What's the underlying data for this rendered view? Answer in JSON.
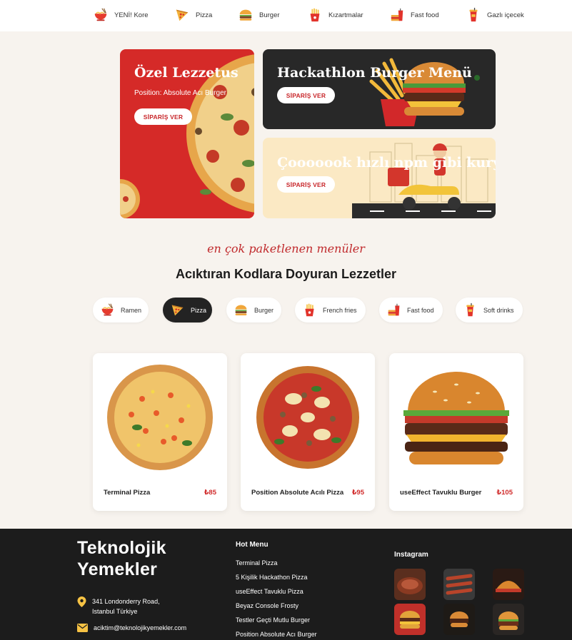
{
  "nav": {
    "items": [
      {
        "label": "YENİ! Kore",
        "icon": "ramen-icon"
      },
      {
        "label": "Pizza",
        "icon": "pizza-icon"
      },
      {
        "label": "Burger",
        "icon": "burger-icon"
      },
      {
        "label": "Kızartmalar",
        "icon": "fries-icon"
      },
      {
        "label": "Fast food",
        "icon": "fast-food-icon"
      },
      {
        "label": "Gazlı içecek",
        "icon": "soda-icon"
      }
    ]
  },
  "hero": {
    "red_card": {
      "title": "Özel Lezzetus",
      "subtitle": "Position: Absolute Acı Burger",
      "button": "SİPARİŞ VER"
    },
    "dark_card": {
      "title": "Hackathlon Burger Menü",
      "button": "SİPARİŞ VER"
    },
    "cream_card": {
      "title": "Çooooook hızlı npm gibi kurye",
      "button": "SİPARİŞ VER"
    }
  },
  "section": {
    "tagline": "en çok paketlenen menüler",
    "title": "Acıktıran Kodlara Doyuran Lezzetler"
  },
  "categories": [
    {
      "label": "Ramen",
      "icon": "ramen-icon",
      "active": false
    },
    {
      "label": "Pizza",
      "icon": "pizza-icon",
      "active": true
    },
    {
      "label": "Burger",
      "icon": "burger-icon",
      "active": false
    },
    {
      "label": "French fries",
      "icon": "fries-icon",
      "active": false
    },
    {
      "label": "Fast food",
      "icon": "fast-food-icon",
      "active": false
    },
    {
      "label": "Soft drinks",
      "icon": "soda-icon",
      "active": false
    }
  ],
  "products": [
    {
      "name": "Terminal Pizza",
      "price": "₺85"
    },
    {
      "name": "Position Absolute Acılı Pizza",
      "price": "₺95"
    },
    {
      "name": "useEffect Tavuklu Burger",
      "price": "₺105"
    }
  ],
  "footer": {
    "brand_line1": "Teknolojik",
    "brand_line2": "Yemekler",
    "address_line1": "341 Londonderry Road,",
    "address_line2": "Istanbul Türkiye",
    "email": "aciktim@teknolojikyemekler.com",
    "hot_menu_title": "Hot Menu",
    "hot_menu": [
      "Terminal Pizza",
      "5 Kişilik Hackathon Pizza",
      "useEffect Tavuklu Pizza",
      "Beyaz Console Frosty",
      "Testler Geçti Mutlu Burger",
      "Position Absolute Acı Burger"
    ],
    "instagram_title": "Instagram"
  },
  "colors": {
    "accent": "#c8262a",
    "hero_red": "#d52a28",
    "hero_dark": "#282828",
    "hero_cream": "#fbe9c4",
    "background": "#f7f3ee",
    "footer": "#1c1c1c"
  }
}
